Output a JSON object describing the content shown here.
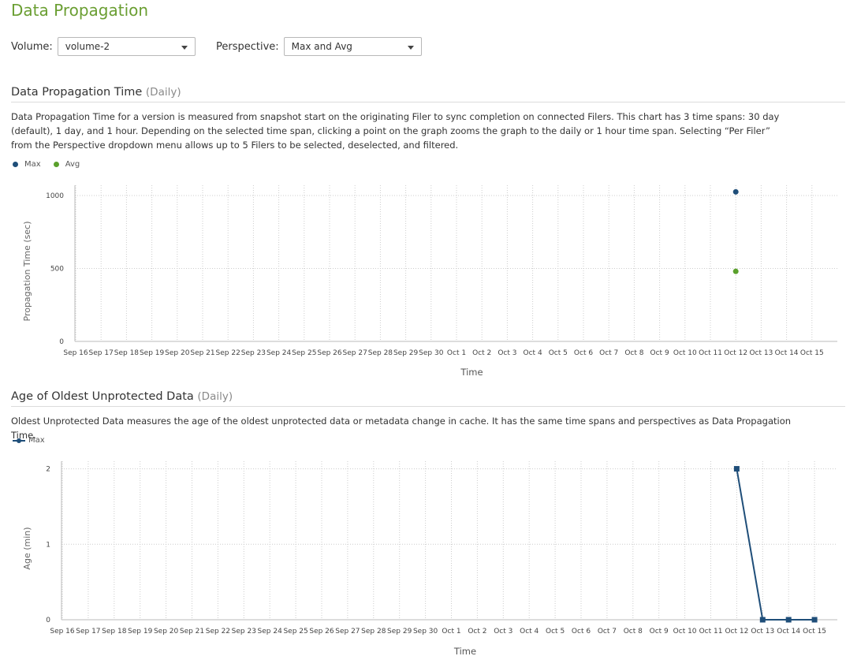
{
  "page": {
    "title": "Data Propagation"
  },
  "filters": {
    "volume_label": "Volume:",
    "volume_value": "volume-2",
    "perspective_label": "Perspective:",
    "perspective_value": "Max and Avg"
  },
  "colors": {
    "max": "#1f4e79",
    "avg": "#5aa02c",
    "title": "#6a9e32",
    "grid": "#cccccc"
  },
  "sections": [
    {
      "title": "Data Propagation Time",
      "subtitle": "(Daily)",
      "description": "Data Propagation Time for a version is measured from snapshot start on the originating Filer to sync completion on connected Filers. This chart has 3 time spans: 30 day (default), 1 day, and 1 hour. Depending on the selected time span, clicking a point on the graph zooms the graph to the daily or 1 hour time span. Selecting “Per Filer” from the Perspective dropdown menu allows up to 5 Filers to be selected, deselected, and filtered.",
      "legend": [
        "Max",
        "Avg"
      ]
    },
    {
      "title": "Age of Oldest Unprotected Data",
      "subtitle": "(Daily)",
      "description": "Oldest Unprotected Data measures the age of the oldest unprotected data or metadata change in cache. It has the same time spans and perspectives as Data Propagation Time.",
      "legend": [
        "Max"
      ]
    }
  ],
  "chart_data": [
    {
      "type": "scatter",
      "categories": [
        "Sep 16",
        "Sep 17",
        "Sep 18",
        "Sep 19",
        "Sep 20",
        "Sep 21",
        "Sep 22",
        "Sep 23",
        "Sep 24",
        "Sep 25",
        "Sep 26",
        "Sep 27",
        "Sep 28",
        "Sep 29",
        "Sep 30",
        "Oct 1",
        "Oct 2",
        "Oct 3",
        "Oct 4",
        "Oct 5",
        "Oct 6",
        "Oct 7",
        "Oct 8",
        "Oct 9",
        "Oct 10",
        "Oct 11",
        "Oct 12",
        "Oct 13",
        "Oct 14",
        "Oct 15"
      ],
      "series": [
        {
          "name": "Max",
          "points": [
            {
              "x": "Oct 12",
              "y": 1025
            }
          ]
        },
        {
          "name": "Avg",
          "points": [
            {
              "x": "Oct 12",
              "y": 480
            }
          ]
        }
      ],
      "xlabel": "Time",
      "ylabel": "Propagation Time (sec)",
      "yticks": [
        0,
        500,
        1000
      ],
      "ylim": [
        0,
        1070
      ],
      "grid": true,
      "legend": "top-left"
    },
    {
      "type": "line",
      "categories": [
        "Sep 16",
        "Sep 17",
        "Sep 18",
        "Sep 19",
        "Sep 20",
        "Sep 21",
        "Sep 22",
        "Sep 23",
        "Sep 24",
        "Sep 25",
        "Sep 26",
        "Sep 27",
        "Sep 28",
        "Sep 29",
        "Sep 30",
        "Oct 1",
        "Oct 2",
        "Oct 3",
        "Oct 4",
        "Oct 5",
        "Oct 6",
        "Oct 7",
        "Oct 8",
        "Oct 9",
        "Oct 10",
        "Oct 11",
        "Oct 12",
        "Oct 13",
        "Oct 14",
        "Oct 15"
      ],
      "series": [
        {
          "name": "Max",
          "points": [
            {
              "x": "Oct 12",
              "y": 2
            },
            {
              "x": "Oct 13",
              "y": 0
            },
            {
              "x": "Oct 14",
              "y": 0
            },
            {
              "x": "Oct 15",
              "y": 0
            }
          ]
        }
      ],
      "xlabel": "Time",
      "ylabel": "Age (min)",
      "yticks": [
        0,
        1,
        2
      ],
      "ylim": [
        0,
        2.1
      ],
      "grid": true,
      "legend": "top-left"
    }
  ]
}
